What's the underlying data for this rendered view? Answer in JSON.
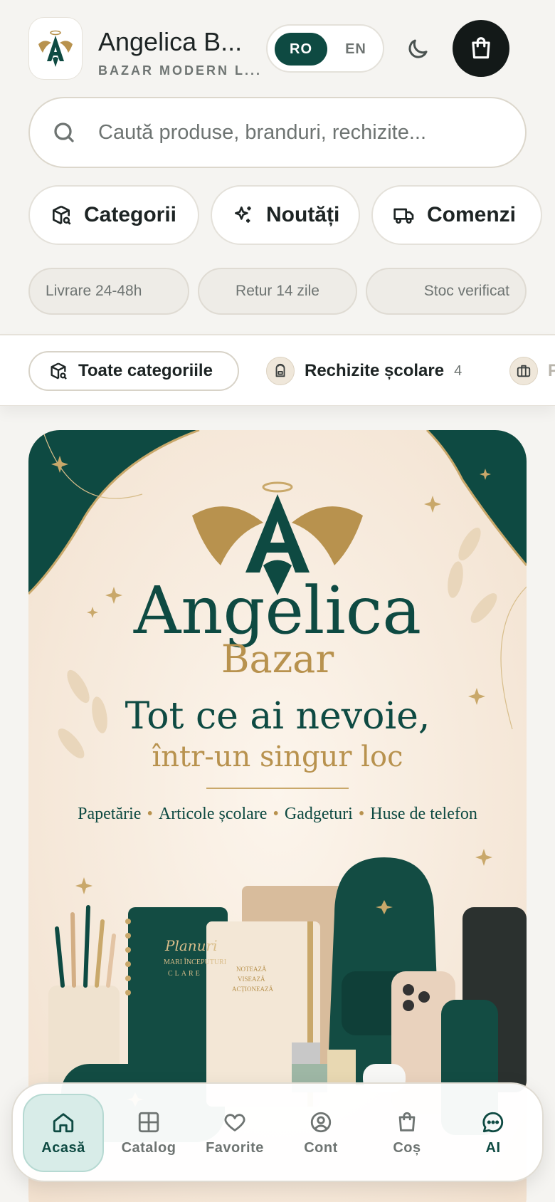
{
  "colors": {
    "primary": "#0e4a42",
    "gold": "#b8924e",
    "background": "#f5f4f1",
    "cart_bg": "#131918"
  },
  "header": {
    "logo_icon": "angel-a-logo-icon",
    "brand_title": "Angelica B...",
    "brand_subtitle": "BAZAR MODERN L...",
    "lang_ro": "RO",
    "lang_en": "EN",
    "lang_selected": "RO",
    "theme_icon": "moon-icon",
    "cart_icon": "shopping-bag-icon"
  },
  "search": {
    "placeholder": "Caută produse, branduri, rechizite...",
    "icon": "search-icon"
  },
  "quick_actions": [
    {
      "label": "Categorii",
      "icon": "box-search-icon"
    },
    {
      "label": "Noutăți",
      "icon": "sparkles-icon"
    },
    {
      "label": "Comenzi",
      "icon": "truck-icon"
    }
  ],
  "pills": [
    "Livrare 24-48h",
    "Retur 14 zile",
    "Stoc verificat"
  ],
  "category_bar": {
    "all_label": "Toate categoriile",
    "all_icon": "box-search-icon",
    "items": [
      {
        "label": "Rechizite școlare",
        "count": "4",
        "icon": "backpack-icon"
      },
      {
        "label": "P",
        "icon": "briefcase-icon"
      }
    ]
  },
  "hero": {
    "brand_line1": "Angelica",
    "brand_line2": "Bazar",
    "headline": "Tot ce ai nevoie,",
    "subheadline": "într-un singur loc",
    "categories": [
      "Papetărie",
      "Articole școlare",
      "Gadgeturi",
      "Huse de telefon"
    ],
    "notebook_title": "Planuri",
    "notebook_sub1": "MARI ÎNCEPUTURI",
    "notebook_sub2": "CLARE",
    "journal_line1": "NOTEAZĂ",
    "journal_line2": "VISEAZĂ",
    "journal_line3": "ACȚIONEAZĂ"
  },
  "bottom_nav": [
    {
      "label": "Acasă",
      "icon": "home-icon",
      "active": true
    },
    {
      "label": "Catalog",
      "icon": "grid-icon"
    },
    {
      "label": "Favorite",
      "icon": "heart-icon"
    },
    {
      "label": "Cont",
      "icon": "user-circle-icon"
    },
    {
      "label": "Coș",
      "icon": "shopping-bag-icon"
    },
    {
      "label": "AI",
      "icon": "chat-bubble-icon"
    }
  ]
}
